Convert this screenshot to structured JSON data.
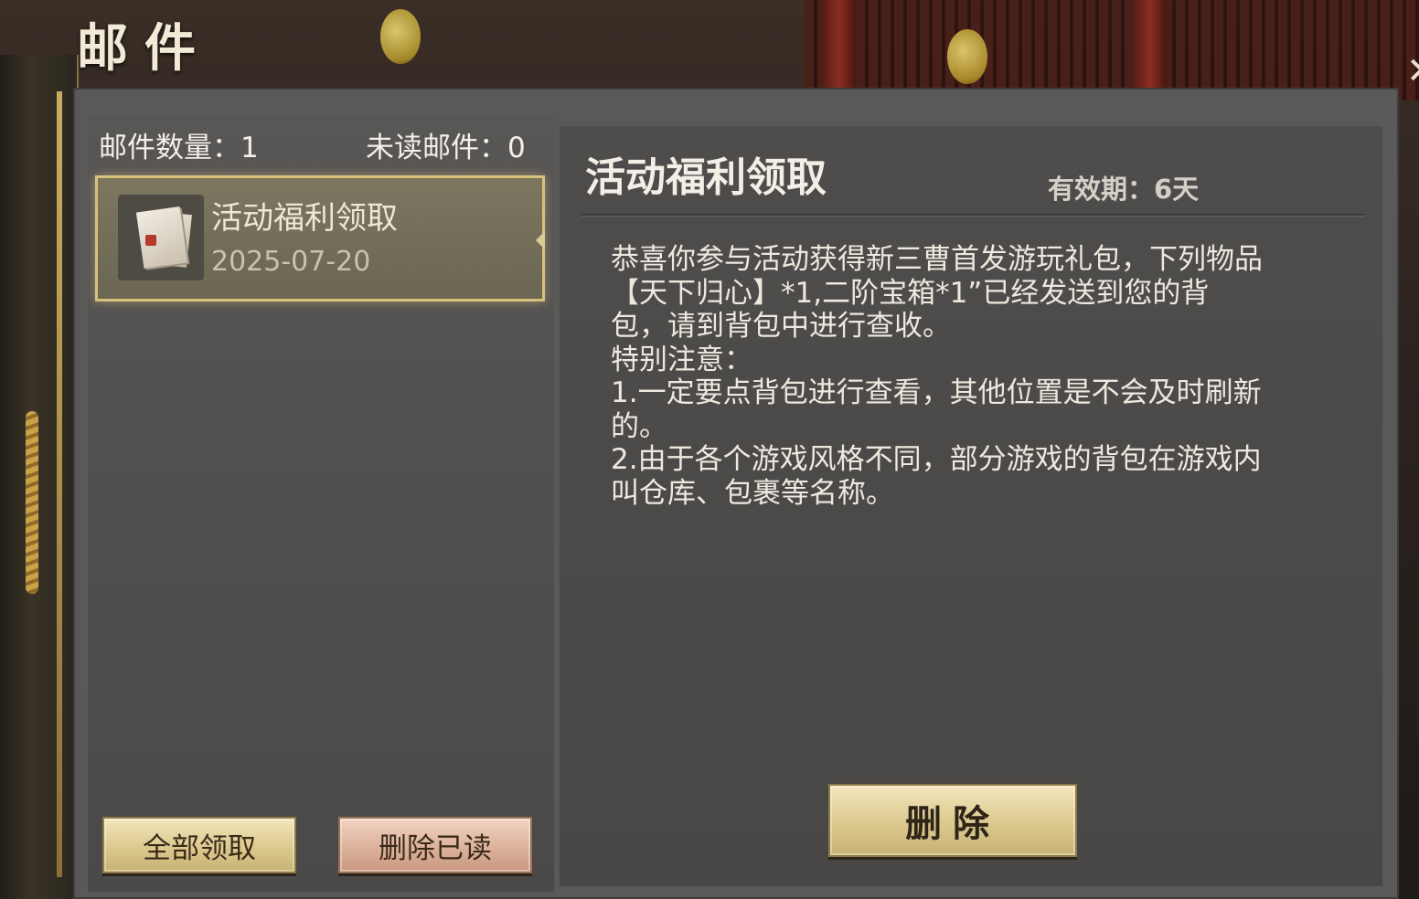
{
  "header": {
    "title": "邮件"
  },
  "stats": {
    "total_label": "邮件数量：1",
    "unread_label": "未读邮件：0"
  },
  "mail_list": [
    {
      "title": "活动福利领取",
      "date": "2025-07-20",
      "icon": "mail-letter-icon"
    }
  ],
  "detail": {
    "title": "活动福利领取",
    "validity": "有效期：6天",
    "body_lines": [
      "恭喜你参与活动获得新三曹首发游玩礼包，下列物品",
      "【天下归心】*1,二阶宝箱*1”已经发送到您的背",
      "包，请到背包中进行查收。",
      "特别注意：",
      "1.一定要点背包进行查看，其他位置是不会及时刷新",
      "的。",
      "2.由于各个游戏风格不同，部分游戏的背包在游戏内",
      "叫仓库、包裹等名称。"
    ]
  },
  "buttons": {
    "claim_all": "全部领取",
    "delete_read": "删除已读",
    "delete": "删除"
  },
  "colors": {
    "gold_border": "#d6c27c",
    "panel_bg": "#5b5957",
    "text_light": "#f3efe6"
  }
}
